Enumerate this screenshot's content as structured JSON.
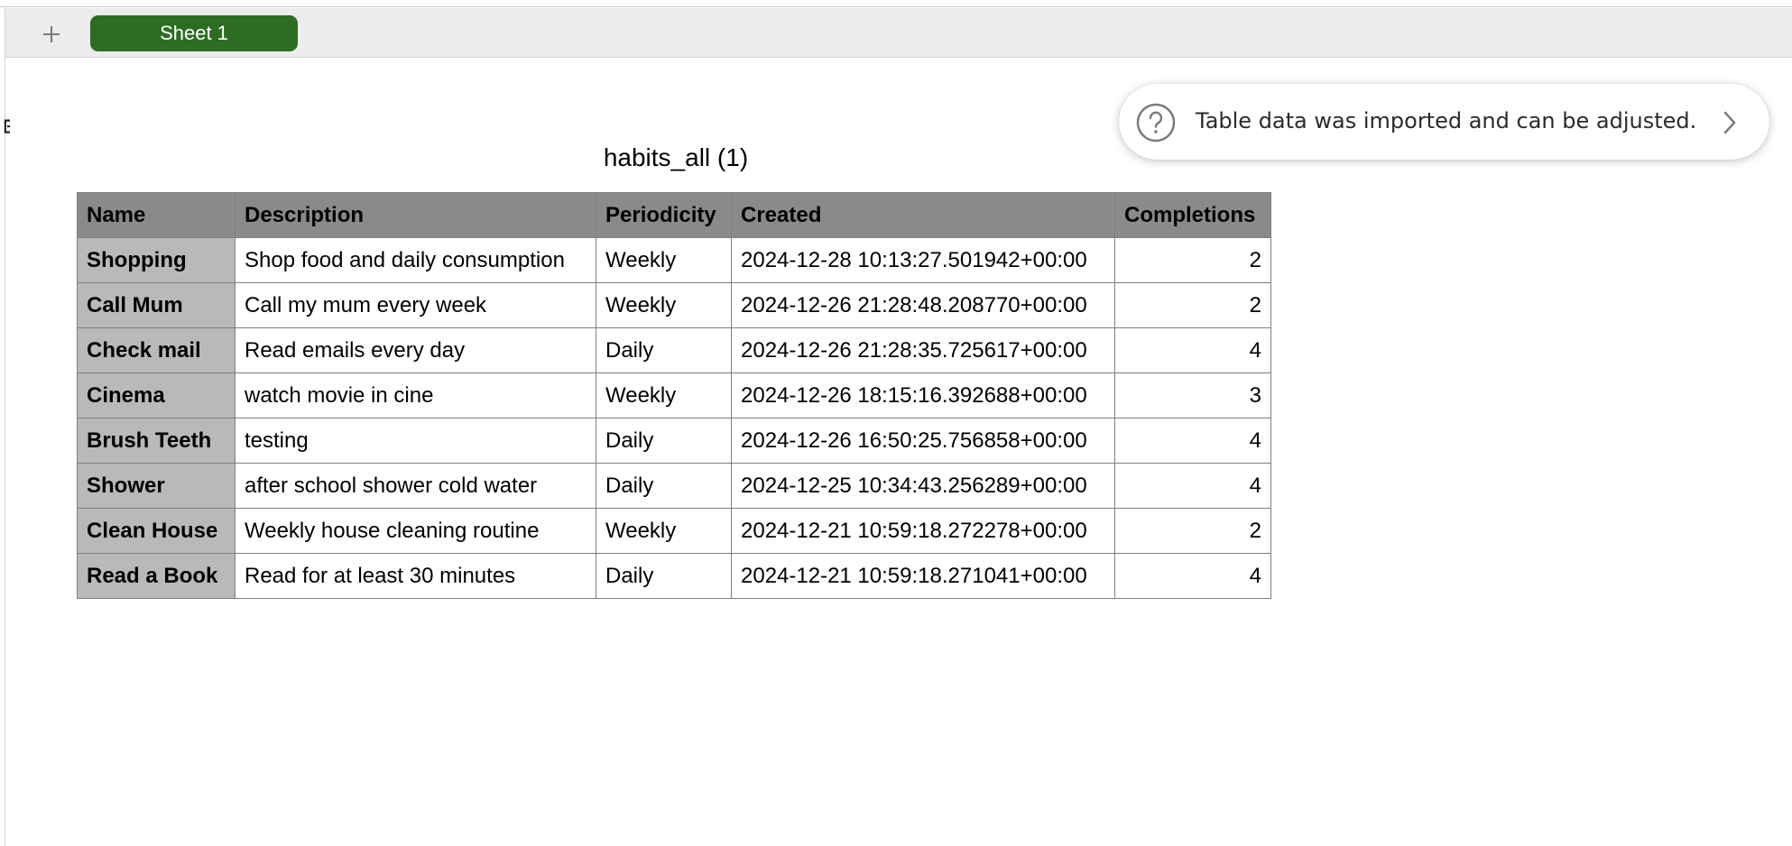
{
  "tabbar": {
    "add_icon": "plus-icon",
    "sheet_tab_label": "Sheet 1",
    "sheet_tab_color": "#2e6b23"
  },
  "notification": {
    "icon": "question-circle-icon",
    "text": "Table data was imported and can be adjusted.",
    "action_icon": "chevron-right-icon"
  },
  "table": {
    "title": "habits_all (1)",
    "header_bg": "#8a8a8a",
    "name_column_bg": "#b9b9b9",
    "columns": [
      "Name",
      "Description",
      "Periodicity",
      "Created",
      "Completions"
    ],
    "rows": [
      {
        "name": "Shopping",
        "description": "Shop food and daily consumption",
        "periodicity": "Weekly",
        "created": "2024-12-28 10:13:27.501942+00:00",
        "completions": "2"
      },
      {
        "name": "Call Mum",
        "description": "Call my mum every week",
        "periodicity": "Weekly",
        "created": "2024-12-26 21:28:48.208770+00:00",
        "completions": "2"
      },
      {
        "name": "Check mail",
        "description": "Read emails every day",
        "periodicity": "Daily",
        "created": "2024-12-26 21:28:35.725617+00:00",
        "completions": "4"
      },
      {
        "name": "Cinema",
        "description": "watch movie in cine",
        "periodicity": "Weekly",
        "created": "2024-12-26 18:15:16.392688+00:00",
        "completions": "3"
      },
      {
        "name": "Brush Teeth",
        "description": "testing",
        "periodicity": "Daily",
        "created": "2024-12-26 16:50:25.756858+00:00",
        "completions": "4"
      },
      {
        "name": "Shower",
        "description": "after school shower cold water",
        "periodicity": "Daily",
        "created": "2024-12-25 10:34:43.256289+00:00",
        "completions": "4"
      },
      {
        "name": "Clean House",
        "description": "Weekly house cleaning routine",
        "periodicity": "Weekly",
        "created": "2024-12-21 10:59:18.272278+00:00",
        "completions": "2"
      },
      {
        "name": "Read a Book",
        "description": "Read for at least 30 minutes",
        "periodicity": "Daily",
        "created": "2024-12-21 10:59:18.271041+00:00",
        "completions": "4"
      }
    ]
  }
}
